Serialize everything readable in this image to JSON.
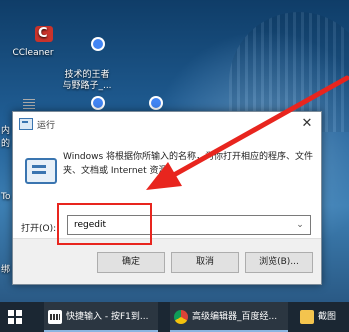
{
  "desktop": {
    "icons": [
      {
        "label": "CCleaner"
      },
      {
        "label": "技术的王者\n与野路子_..."
      }
    ],
    "fragments": [
      "内",
      "的",
      "To",
      "绑"
    ]
  },
  "dialog": {
    "title": "运行",
    "description": "Windows 将根据你所输入的名称，为你打开相应的程序、文件夹、文档或 Internet 资源。",
    "open_label": "打开(O):",
    "input_value": "regedit",
    "buttons": {
      "ok": "确定",
      "cancel": "取消",
      "browse": "浏览(B)..."
    }
  },
  "taskbar": {
    "items": [
      {
        "label": "快捷输入 - 按F1到..."
      },
      {
        "label": "高级编辑器_百度经..."
      },
      {
        "label": "截图"
      }
    ]
  },
  "colors": {
    "highlight": "#e8251e",
    "arrow": "#e8251e",
    "taskbar": "#1b2733"
  }
}
